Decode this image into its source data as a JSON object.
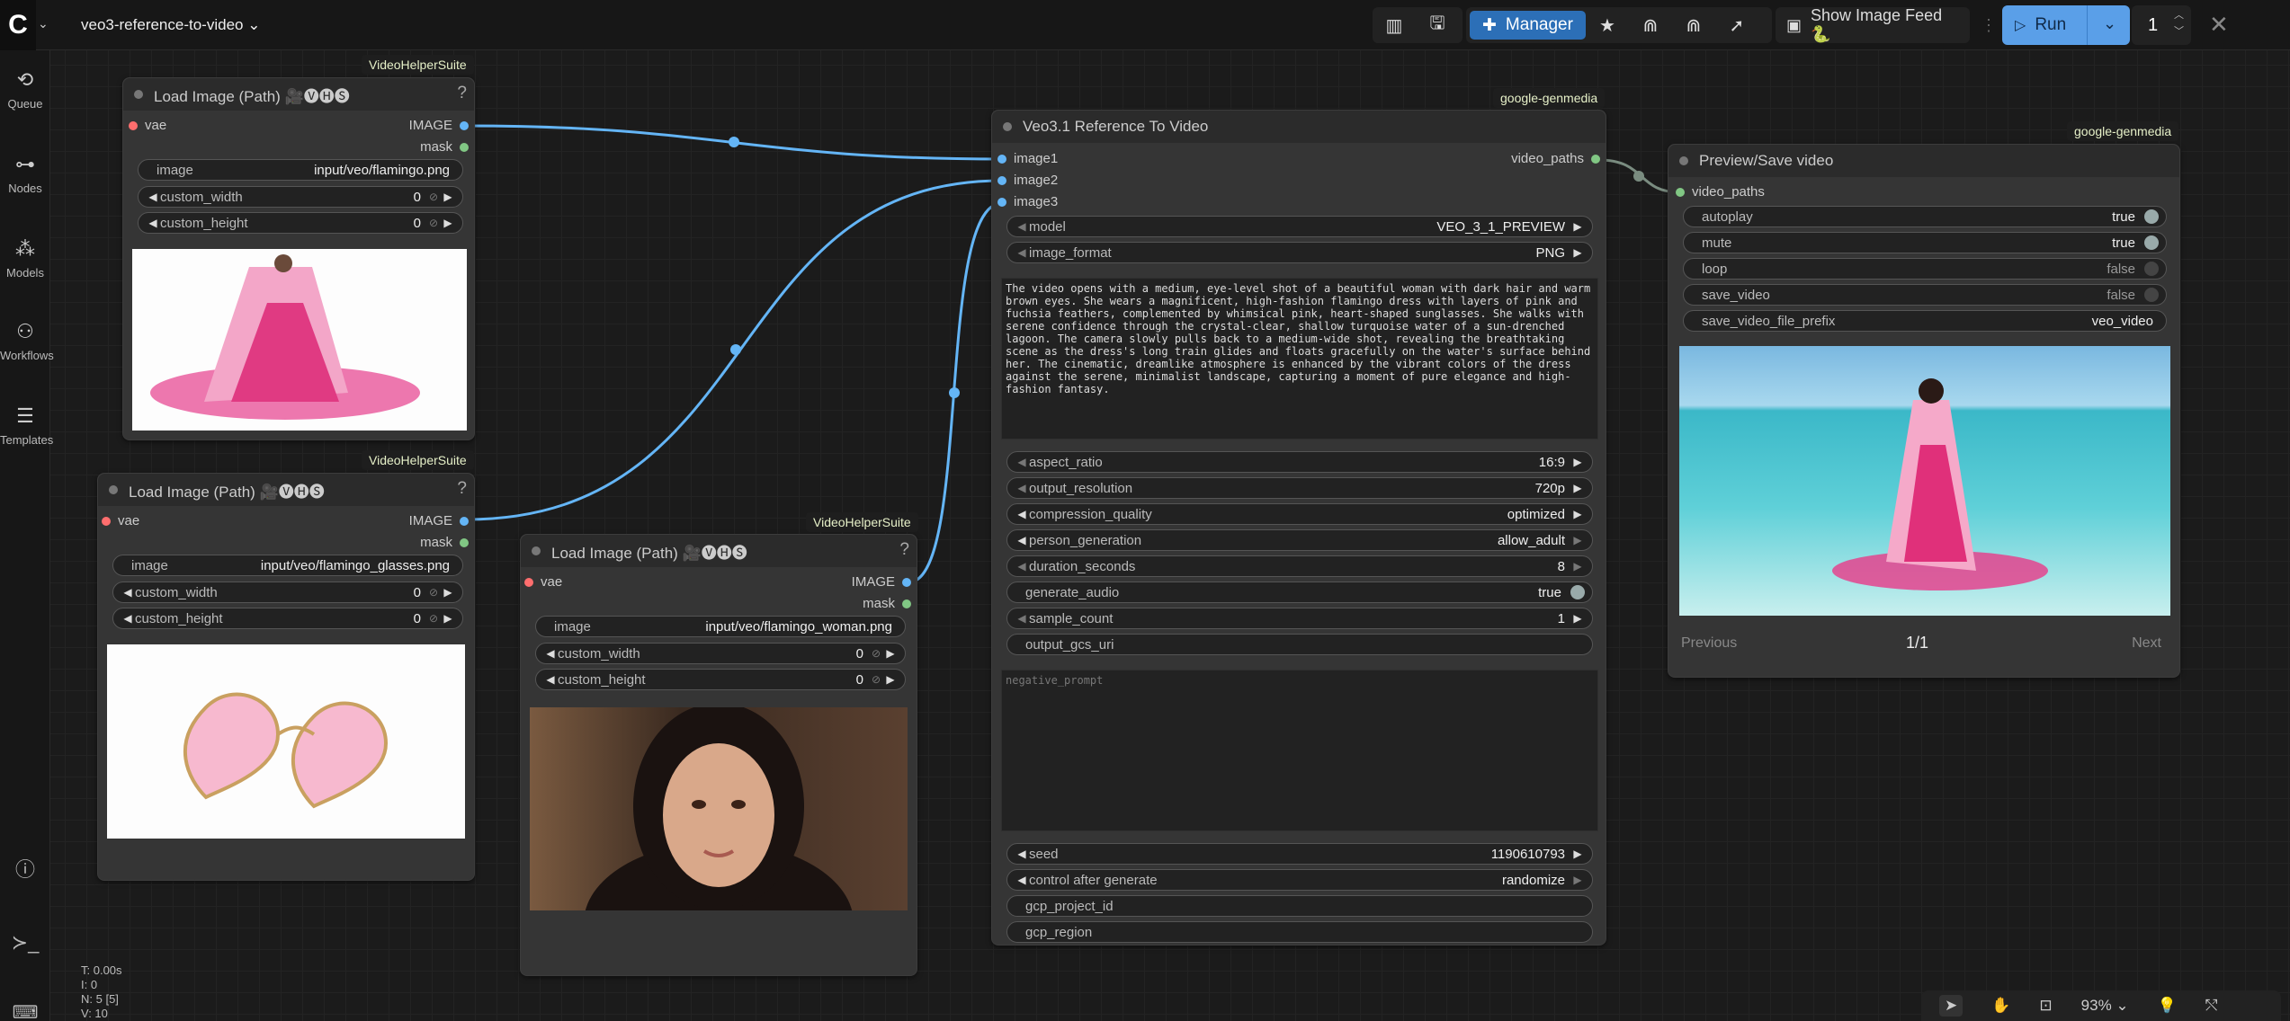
{
  "app": {
    "workflow_title": "veo3-reference-to-video"
  },
  "toolbar": {
    "manager_label": "Manager",
    "image_feed_label": "Show Image Feed 🐍",
    "run_label": "Run",
    "queue_count": "1"
  },
  "sidebar": {
    "items": [
      {
        "label": "Queue",
        "icon": "history-icon"
      },
      {
        "label": "Nodes",
        "icon": "nodes-icon"
      },
      {
        "label": "Models",
        "icon": "models-icon"
      },
      {
        "label": "Workflows",
        "icon": "workflows-icon"
      },
      {
        "label": "Templates",
        "icon": "templates-icon"
      }
    ]
  },
  "nodes": {
    "load1": {
      "badge": "VideoHelperSuite",
      "title": "Load Image (Path) 🎥🅥🅗🅢",
      "in_vae": "vae",
      "out_image": "IMAGE",
      "out_mask": "mask",
      "image_label": "image",
      "image_value": "input/veo/flamingo.png",
      "w_label": "custom_width",
      "w_value": "0",
      "h_label": "custom_height",
      "h_value": "0"
    },
    "load2": {
      "badge": "VideoHelperSuite",
      "title": "Load Image (Path) 🎥🅥🅗🅢",
      "in_vae": "vae",
      "out_image": "IMAGE",
      "out_mask": "mask",
      "image_label": "image",
      "image_value": "input/veo/flamingo_glasses.png",
      "w_label": "custom_width",
      "w_value": "0",
      "h_label": "custom_height",
      "h_value": "0"
    },
    "load3": {
      "badge": "VideoHelperSuite",
      "title": "Load Image (Path) 🎥🅥🅗🅢",
      "in_vae": "vae",
      "out_image": "IMAGE",
      "out_mask": "mask",
      "image_label": "image",
      "image_value": "input/veo/flamingo_woman.png",
      "w_label": "custom_width",
      "w_value": "0",
      "h_label": "custom_height",
      "h_value": "0"
    },
    "veo": {
      "badge": "google-genmedia",
      "title": "Veo3.1 Reference To Video",
      "inputs": [
        "image1",
        "image2",
        "image3"
      ],
      "output": "video_paths",
      "model_label": "model",
      "model_value": "VEO_3_1_PREVIEW",
      "format_label": "image_format",
      "format_value": "PNG",
      "prompt": "The video opens with a medium, eye-level shot of a beautiful woman with dark hair and warm brown eyes. She wears a magnificent, high-fashion flamingo dress with layers of pink and fuchsia feathers, complemented by whimsical pink, heart-shaped sunglasses. She walks with serene confidence through the crystal-clear, shallow turquoise water of a sun-drenched lagoon. The camera slowly pulls back to a medium-wide shot, revealing the breathtaking scene as the dress's long train glides and floats gracefully on the water's surface behind her. The cinematic, dreamlike atmosphere is enhanced by the vibrant colors of the dress against the serene, minimalist landscape, capturing a moment of pure elegance and high-fashion fantasy.",
      "aspect_label": "aspect_ratio",
      "aspect_value": "16:9",
      "res_label": "output_resolution",
      "res_value": "720p",
      "comp_label": "compression_quality",
      "comp_value": "optimized",
      "person_label": "person_generation",
      "person_value": "allow_adult",
      "dur_label": "duration_seconds",
      "dur_value": "8",
      "audio_label": "generate_audio",
      "audio_value": "true",
      "count_label": "sample_count",
      "count_value": "1",
      "gcs_label": "output_gcs_uri",
      "neg_placeholder": "negative_prompt",
      "seed_label": "seed",
      "seed_value": "1190610793",
      "cag_label": "control after generate",
      "cag_value": "randomize",
      "proj_label": "gcp_project_id",
      "region_label": "gcp_region"
    },
    "preview": {
      "badge": "google-genmedia",
      "title": "Preview/Save video",
      "input": "video_paths",
      "autoplay_label": "autoplay",
      "autoplay_value": "true",
      "mute_label": "mute",
      "mute_value": "true",
      "loop_label": "loop",
      "loop_value": "false",
      "save_label": "save_video",
      "save_value": "false",
      "prefix_label": "save_video_file_prefix",
      "prefix_value": "veo_video",
      "prev_label": "Previous",
      "page": "1/1",
      "next_label": "Next"
    }
  },
  "canvas": {
    "stats": [
      "T: 0.00s",
      "I: 0",
      "N: 5 [5]",
      "V: 10"
    ],
    "zoom": "93%"
  },
  "colors": {
    "accent": "#5a9fe8",
    "image_link": "#64b5f6",
    "mask_slot": "#81c784",
    "vae_slot": "#ff6e6e",
    "badge_text": "#e6f0c8"
  }
}
